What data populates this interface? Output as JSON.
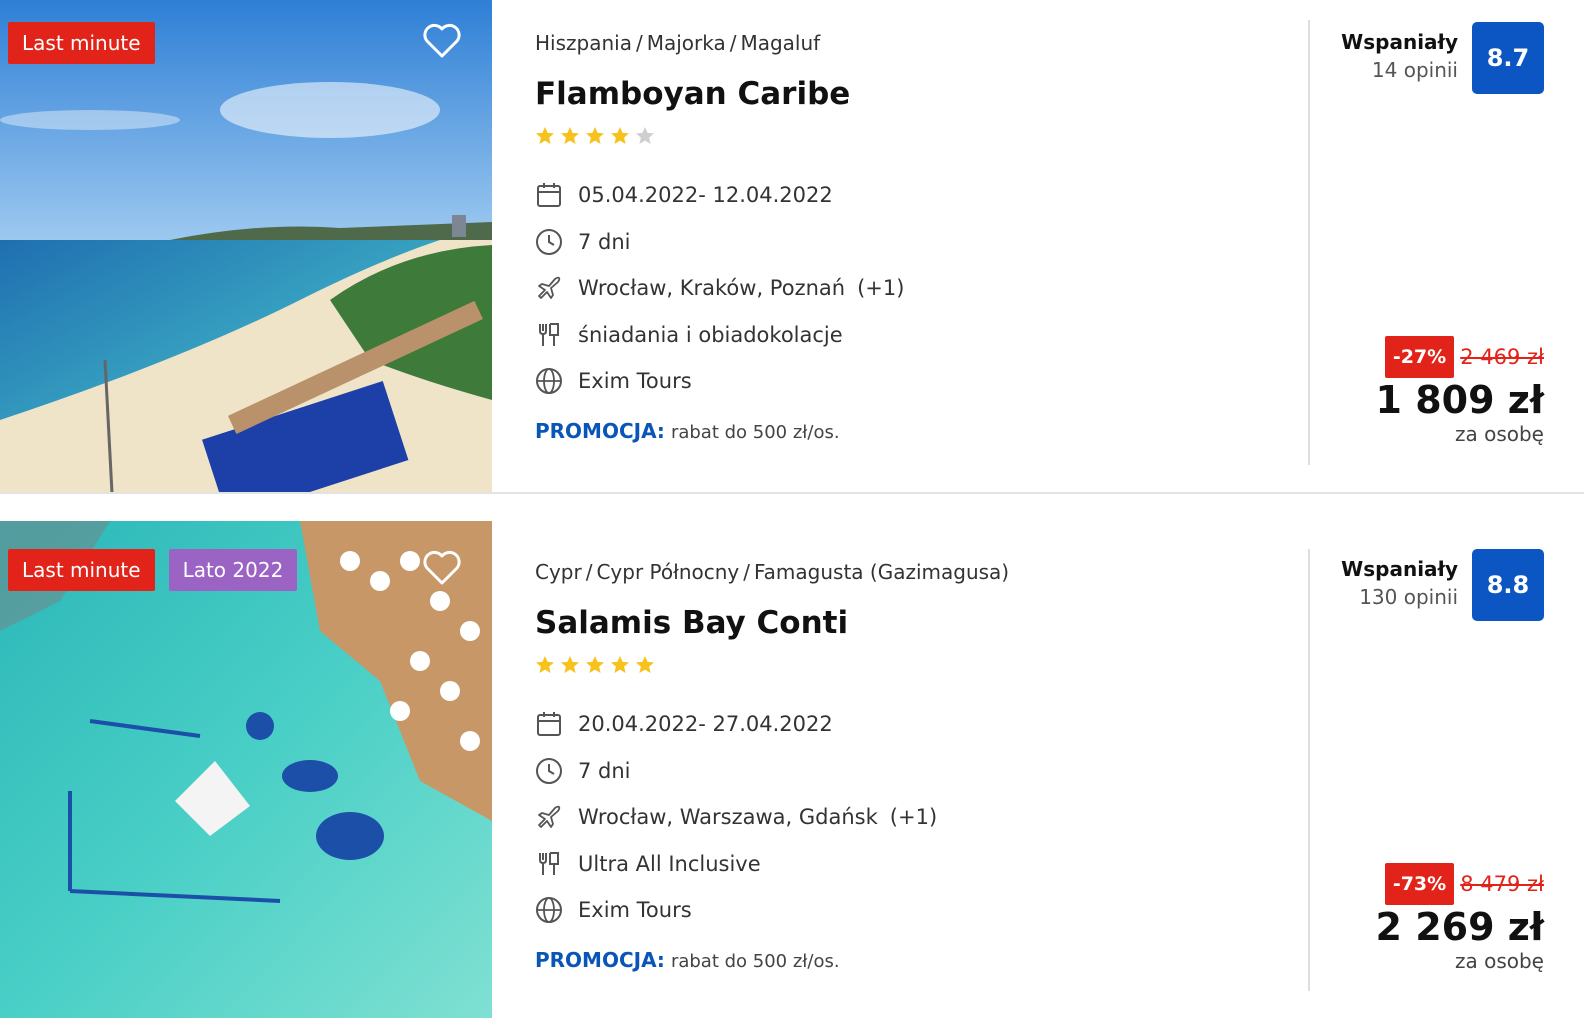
{
  "offers": [
    {
      "badges": [
        "Last minute"
      ],
      "breadcrumb": [
        "Hiszpania",
        "Majorka",
        "Magaluf"
      ],
      "name": "Flamboyan Caribe",
      "stars": 4,
      "dates": "05.04.2022- 12.04.2022",
      "duration": "7 dni",
      "departures": "Wrocław, Kraków, Poznań",
      "departures_extra": "(+1)",
      "board": "śniadania i obiadokolacje",
      "operator": "Exim Tours",
      "promo_label": "PROMOCJA:",
      "promo_text": "rabat do 500 zł/os.",
      "rating_label": "Wspaniały",
      "rating_count": "14 opinii",
      "rating_score": "8.7",
      "discount": "-27%",
      "old_price": "2 469 zł",
      "price": "1 809 zł",
      "per_person": "za osobę"
    },
    {
      "badges": [
        "Last minute",
        "Lato 2022"
      ],
      "breadcrumb": [
        "Cypr",
        "Cypr Północny",
        "Famagusta (Gazimagusa)"
      ],
      "name": "Salamis Bay Conti",
      "stars": 5,
      "dates": "20.04.2022- 27.04.2022",
      "duration": "7 dni",
      "departures": "Wrocław, Warszawa, Gdańsk",
      "departures_extra": "(+1)",
      "board": "Ultra All Inclusive",
      "operator": "Exim Tours",
      "promo_label": "PROMOCJA:",
      "promo_text": "rabat do 500 zł/os.",
      "rating_label": "Wspaniały",
      "rating_count": "130 opinii",
      "rating_score": "8.8",
      "discount": "-73%",
      "old_price": "8 479 zł",
      "price": "2 269 zł",
      "per_person": "za osobę"
    }
  ],
  "colors": {
    "badge_red": "#e2231a",
    "badge_purple": "#9a63c4",
    "rating_blue": "#0b56c2",
    "promo_blue": "#0a55b8",
    "star_gold": "#f7c21c",
    "star_grey": "#cfcfcf"
  },
  "icons": [
    "heart-icon",
    "calendar-icon",
    "clock-icon",
    "plane-icon",
    "cutlery-icon",
    "globe-icon",
    "star-icon"
  ]
}
